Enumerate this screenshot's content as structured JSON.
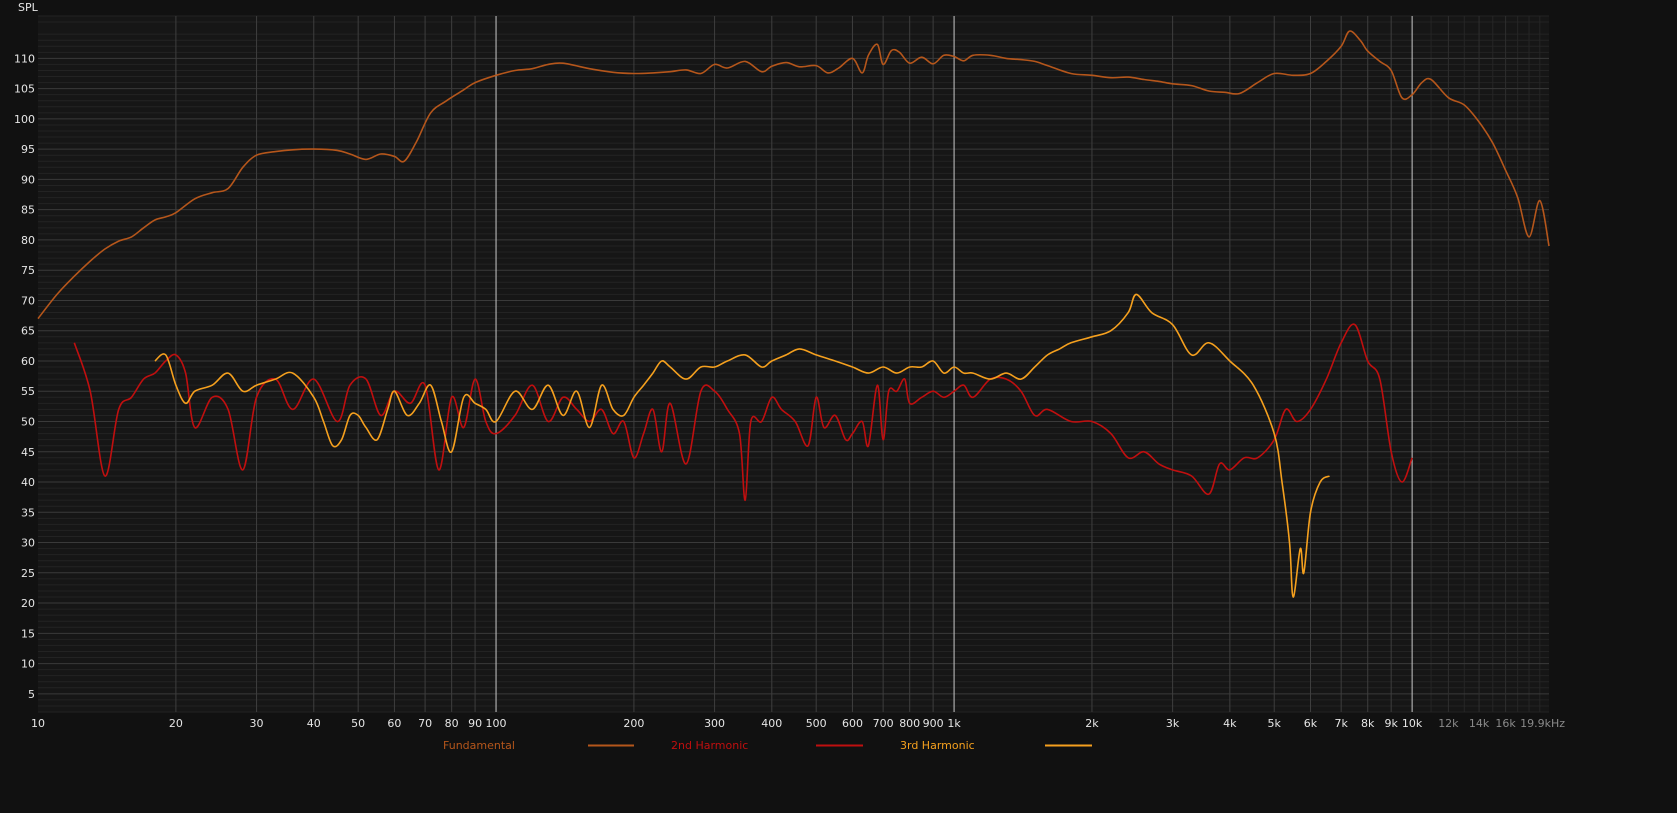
{
  "chart_data": {
    "type": "line",
    "ylabel": "SPL",
    "x_scale": "log",
    "xlim": [
      10,
      19900
    ],
    "ylim": [
      2,
      117
    ],
    "grid": true,
    "legend_position": "bottom",
    "x_ticks": [
      {
        "value": 10,
        "label": "10"
      },
      {
        "value": 20,
        "label": "20"
      },
      {
        "value": 30,
        "label": "30"
      },
      {
        "value": 40,
        "label": "40"
      },
      {
        "value": 50,
        "label": "50"
      },
      {
        "value": 60,
        "label": "60"
      },
      {
        "value": 70,
        "label": "70"
      },
      {
        "value": 80,
        "label": "80"
      },
      {
        "value": 90,
        "label": "90"
      },
      {
        "value": 100,
        "label": "100"
      },
      {
        "value": 200,
        "label": "200"
      },
      {
        "value": 300,
        "label": "300"
      },
      {
        "value": 400,
        "label": "400"
      },
      {
        "value": 500,
        "label": "500"
      },
      {
        "value": 600,
        "label": "600"
      },
      {
        "value": 700,
        "label": "700"
      },
      {
        "value": 800,
        "label": "800"
      },
      {
        "value": 900,
        "label": "900"
      },
      {
        "value": 1000,
        "label": "1k"
      },
      {
        "value": 2000,
        "label": "2k"
      },
      {
        "value": 3000,
        "label": "3k"
      },
      {
        "value": 4000,
        "label": "4k"
      },
      {
        "value": 5000,
        "label": "5k"
      },
      {
        "value": 6000,
        "label": "6k"
      },
      {
        "value": 7000,
        "label": "7k"
      },
      {
        "value": 8000,
        "label": "8k"
      },
      {
        "value": 9000,
        "label": "9k"
      },
      {
        "value": 10000,
        "label": "10k"
      },
      {
        "value": 12000,
        "label": "12k"
      },
      {
        "value": 14000,
        "label": "14k"
      },
      {
        "value": 16000,
        "label": "16k"
      },
      {
        "value": 19900,
        "label": "19.9kHz"
      }
    ],
    "y_ticks": [
      5,
      10,
      15,
      20,
      25,
      30,
      35,
      40,
      45,
      50,
      55,
      60,
      65,
      70,
      75,
      80,
      85,
      90,
      95,
      100,
      105,
      110
    ],
    "series": [
      {
        "name": "Fundamental",
        "color": "#b5561b",
        "x": [
          10,
          11,
          12,
          13,
          14,
          15,
          16,
          17,
          18,
          19,
          20,
          22,
          24,
          26,
          28,
          30,
          33,
          36,
          40,
          45,
          48,
          52,
          56,
          60,
          63,
          67,
          72,
          78,
          85,
          90,
          100,
          110,
          120,
          130,
          140,
          160,
          180,
          200,
          220,
          240,
          260,
          280,
          300,
          320,
          350,
          380,
          400,
          430,
          460,
          500,
          530,
          560,
          600,
          630,
          650,
          680,
          700,
          730,
          760,
          800,
          850,
          900,
          950,
          1000,
          1050,
          1100,
          1200,
          1300,
          1400,
          1500,
          1600,
          1800,
          2000,
          2200,
          2400,
          2600,
          2800,
          3000,
          3300,
          3600,
          3900,
          4200,
          4600,
          5000,
          5500,
          6000,
          6500,
          7000,
          7300,
          7700,
          8000,
          8500,
          9000,
          9500,
          10000,
          10500,
          11000,
          12000,
          13000,
          14000,
          15000,
          16000,
          17000,
          18000,
          19000,
          19900
        ],
        "y": [
          67,
          71,
          74,
          76.5,
          78.5,
          79.8,
          80.5,
          82,
          83.3,
          83.8,
          84.5,
          86.8,
          87.8,
          88.5,
          92,
          94,
          94.6,
          94.9,
          95,
          94.8,
          94.2,
          93.3,
          94.2,
          93.8,
          93,
          96.2,
          101,
          103,
          104.8,
          106,
          107.2,
          108,
          108.3,
          109,
          109.2,
          108.3,
          107.7,
          107.5,
          107.6,
          107.8,
          108.1,
          107.5,
          109,
          108.4,
          109.5,
          107.8,
          108.7,
          109.3,
          108.6,
          108.8,
          107.6,
          108.4,
          110,
          107.6,
          110.5,
          112.3,
          109,
          111.3,
          111,
          109.2,
          110.2,
          109.1,
          110.5,
          110.3,
          109.6,
          110.5,
          110.5,
          110,
          109.8,
          109.5,
          108.8,
          107.5,
          107.2,
          106.8,
          106.9,
          106.5,
          106.2,
          105.8,
          105.5,
          104.6,
          104.4,
          104.2,
          106,
          107.5,
          107.2,
          107.5,
          109.5,
          112,
          114.5,
          113,
          111.2,
          109.5,
          108,
          103.5,
          104,
          106,
          106.5,
          103.5,
          102.3,
          99.5,
          96,
          91.5,
          87,
          80.5,
          86.5,
          79
        ]
      },
      {
        "name": "2nd Harmonic",
        "color": "#c00f0f",
        "x": [
          12,
          13,
          14,
          15,
          16,
          17,
          18,
          19,
          20,
          21,
          22,
          24,
          26,
          28,
          30,
          33,
          36,
          40,
          45,
          48,
          52,
          56,
          60,
          65,
          70,
          75,
          80,
          85,
          90,
          95,
          100,
          110,
          120,
          130,
          140,
          150,
          160,
          170,
          180,
          190,
          200,
          210,
          220,
          230,
          240,
          260,
          280,
          300,
          320,
          340,
          350,
          360,
          380,
          400,
          420,
          450,
          480,
          500,
          520,
          550,
          580,
          600,
          630,
          650,
          680,
          700,
          720,
          750,
          780,
          800,
          850,
          900,
          950,
          1000,
          1050,
          1100,
          1200,
          1300,
          1400,
          1500,
          1600,
          1800,
          2000,
          2200,
          2400,
          2600,
          2800,
          3000,
          3300,
          3600,
          3800,
          4000,
          4300,
          4600,
          5000,
          5300,
          5600,
          6000,
          6500,
          7000,
          7500,
          8000,
          8500,
          9000,
          9500,
          10000
        ],
        "y": [
          63,
          55,
          41,
          52,
          54,
          57,
          58,
          60,
          61,
          58,
          49,
          54,
          52,
          42,
          54,
          57,
          52,
          57,
          50,
          56,
          57,
          51,
          55,
          53,
          56,
          42,
          54,
          49,
          57,
          50,
          48,
          51,
          56,
          50,
          54,
          52,
          50,
          52,
          48,
          50,
          44,
          48,
          52,
          45,
          53,
          43,
          55,
          55,
          52,
          48,
          37,
          50,
          50,
          54,
          52,
          50,
          46,
          54,
          49,
          51,
          47,
          48,
          50,
          46,
          56,
          47,
          55,
          55,
          57,
          53,
          54,
          55,
          54,
          55,
          56,
          54,
          57,
          57,
          55,
          51,
          52,
          50,
          50,
          48,
          44,
          45,
          43,
          42,
          41,
          38,
          43,
          42,
          44,
          44,
          47,
          52,
          50,
          52,
          57,
          63,
          66,
          60,
          57,
          45,
          40,
          44
        ]
      },
      {
        "name": "3rd Harmonic",
        "color": "#f5a01e",
        "x": [
          18,
          19,
          20,
          21,
          22,
          24,
          26,
          28,
          30,
          33,
          36,
          40,
          42,
          44,
          46,
          48,
          50,
          52,
          55,
          58,
          60,
          64,
          68,
          72,
          76,
          80,
          85,
          90,
          95,
          100,
          110,
          120,
          130,
          140,
          150,
          160,
          170,
          180,
          190,
          200,
          210,
          220,
          230,
          240,
          260,
          280,
          300,
          320,
          350,
          380,
          400,
          430,
          460,
          500,
          550,
          600,
          650,
          700,
          750,
          800,
          850,
          900,
          950,
          1000,
          1050,
          1100,
          1200,
          1300,
          1400,
          1500,
          1600,
          1700,
          1800,
          2000,
          2200,
          2400,
          2500,
          2700,
          3000,
          3300,
          3600,
          4000,
          4500,
          5000,
          5200,
          5400,
          5500,
          5700,
          5800,
          6000,
          6300,
          6600
        ],
        "y": [
          60,
          61,
          56,
          53,
          55,
          56,
          58,
          55,
          56,
          57,
          58,
          54,
          50,
          46,
          47,
          51,
          51,
          49,
          47,
          52,
          55,
          51,
          53,
          56,
          50,
          45,
          54,
          53,
          52,
          50,
          55,
          52,
          56,
          51,
          55,
          49,
          56,
          52,
          51,
          54,
          56,
          58,
          60,
          59,
          57,
          59,
          59,
          60,
          61,
          59,
          60,
          61,
          62,
          61,
          60,
          59,
          58,
          59,
          58,
          59,
          59,
          60,
          58,
          59,
          58,
          58,
          57,
          58,
          57,
          59,
          61,
          62,
          63,
          64,
          65,
          68,
          71,
          68,
          66,
          61,
          63,
          60,
          56,
          48,
          40,
          30,
          21,
          29,
          25,
          35,
          40,
          41
        ]
      }
    ]
  },
  "legend": [
    {
      "label": "Fundamental",
      "color": "#b5561b"
    },
    {
      "label": "2nd Harmonic",
      "color": "#c00f0f"
    },
    {
      "label": "3rd Harmonic",
      "color": "#f5a01e"
    }
  ]
}
